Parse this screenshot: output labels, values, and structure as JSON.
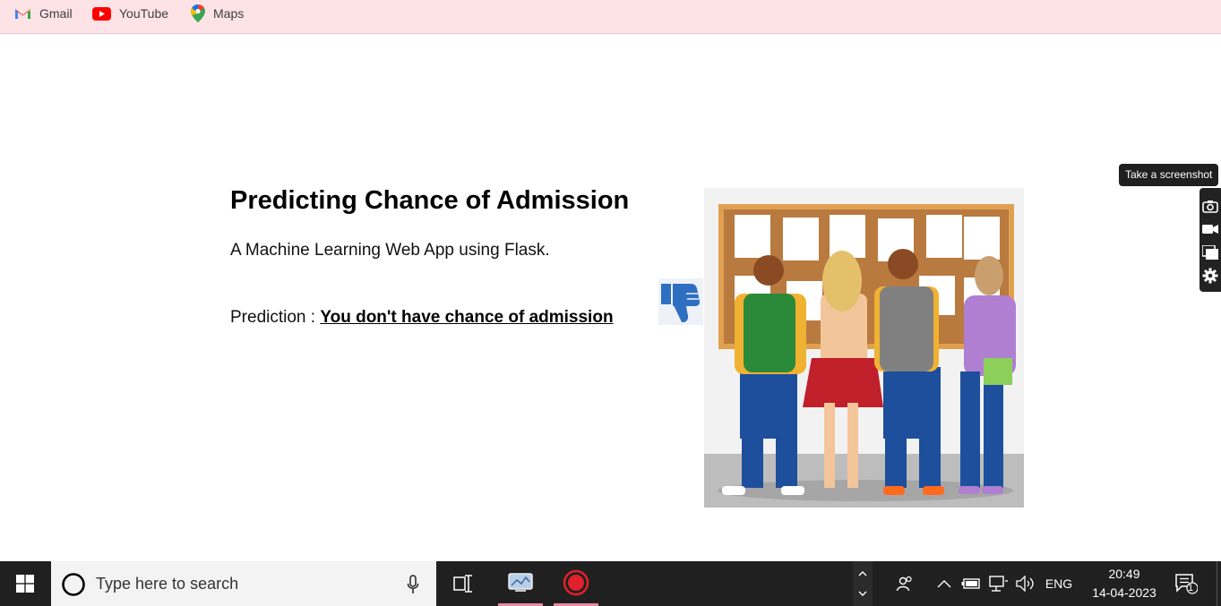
{
  "bookmarks": [
    {
      "label": "Gmail",
      "icon": "gmail-icon"
    },
    {
      "label": "YouTube",
      "icon": "youtube-icon"
    },
    {
      "label": "Maps",
      "icon": "maps-icon"
    }
  ],
  "page": {
    "title": "Predicting Chance of Admission",
    "subtitle": "A Machine Learning Web App using Flask.",
    "prediction_label": "Prediction : ",
    "prediction_result": "You don't have chance of admission",
    "result_icon": "thumbs-down-icon"
  },
  "screenshot_tool": {
    "tooltip": "Take a screenshot",
    "buttons": [
      "camera-icon",
      "video-icon",
      "gallery-icon",
      "gear-icon"
    ]
  },
  "taskbar": {
    "search_placeholder": "Type here to search",
    "language": "ENG",
    "time": "20:49",
    "date": "14-04-2023",
    "notifications": "1"
  },
  "colors": {
    "bookmark_bar": "#fde2e6",
    "taskbar": "#202020",
    "thumb": "#2f6fc1"
  }
}
